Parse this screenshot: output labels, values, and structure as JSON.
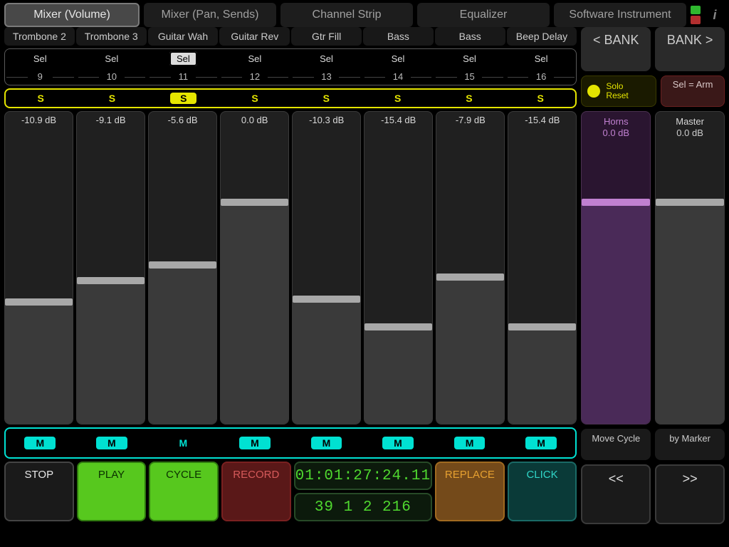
{
  "modes": [
    "Mixer (Volume)",
    "Mixer (Pan, Sends)",
    "Channel Strip",
    "Equalizer",
    "Software Instrument"
  ],
  "active_mode": 0,
  "channels": [
    {
      "name": "Trombone 2",
      "num": "9",
      "db": "-10.9 dB",
      "solo": false,
      "sel": false,
      "mute_on": true,
      "fill": 39
    },
    {
      "name": "Trombone 3",
      "num": "10",
      "db": "-9.1 dB",
      "solo": false,
      "sel": false,
      "mute_on": true,
      "fill": 46
    },
    {
      "name": "Guitar Wah",
      "num": "11",
      "db": "-5.6 dB",
      "solo": true,
      "sel": true,
      "mute_on": false,
      "fill": 51
    },
    {
      "name": "Guitar Rev",
      "num": "12",
      "db": "0.0 dB",
      "solo": false,
      "sel": false,
      "mute_on": true,
      "fill": 71
    },
    {
      "name": "Gtr Fill",
      "num": "13",
      "db": "-10.3 dB",
      "solo": false,
      "sel": false,
      "mute_on": true,
      "fill": 40
    },
    {
      "name": "Bass",
      "num": "14",
      "db": "-15.4 dB",
      "solo": false,
      "sel": false,
      "mute_on": true,
      "fill": 31
    },
    {
      "name": "Bass",
      "num": "15",
      "db": "-7.9 dB",
      "solo": false,
      "sel": false,
      "mute_on": true,
      "fill": 47
    },
    {
      "name": "Beep Delay",
      "num": "16",
      "db": "-15.4 dB",
      "solo": false,
      "sel": false,
      "mute_on": true,
      "fill": 31
    }
  ],
  "sel_label": "Sel",
  "solo_label": "S",
  "mute_label": "M",
  "bank_prev": "< BANK",
  "bank_next": "BANK >",
  "solo_reset": "Solo\nReset",
  "sel_arm": "Sel = Arm",
  "bus": [
    {
      "name": "Horns",
      "db": "0.0 dB",
      "kind": "horns",
      "fill": 71
    },
    {
      "name": "Master",
      "db": "0.0 dB",
      "kind": "master",
      "fill": 71
    }
  ],
  "side_actions": [
    "Move Cycle",
    "by Marker"
  ],
  "seek": [
    "<<",
    ">>"
  ],
  "transport": {
    "stop": "STOP",
    "play": "PLAY",
    "cycle": "CYCLE",
    "record": "RECORD",
    "replace": "REPLACE",
    "click": "CLICK",
    "time": "01:01:27:24.11",
    "bars": "39  1  2 216"
  }
}
